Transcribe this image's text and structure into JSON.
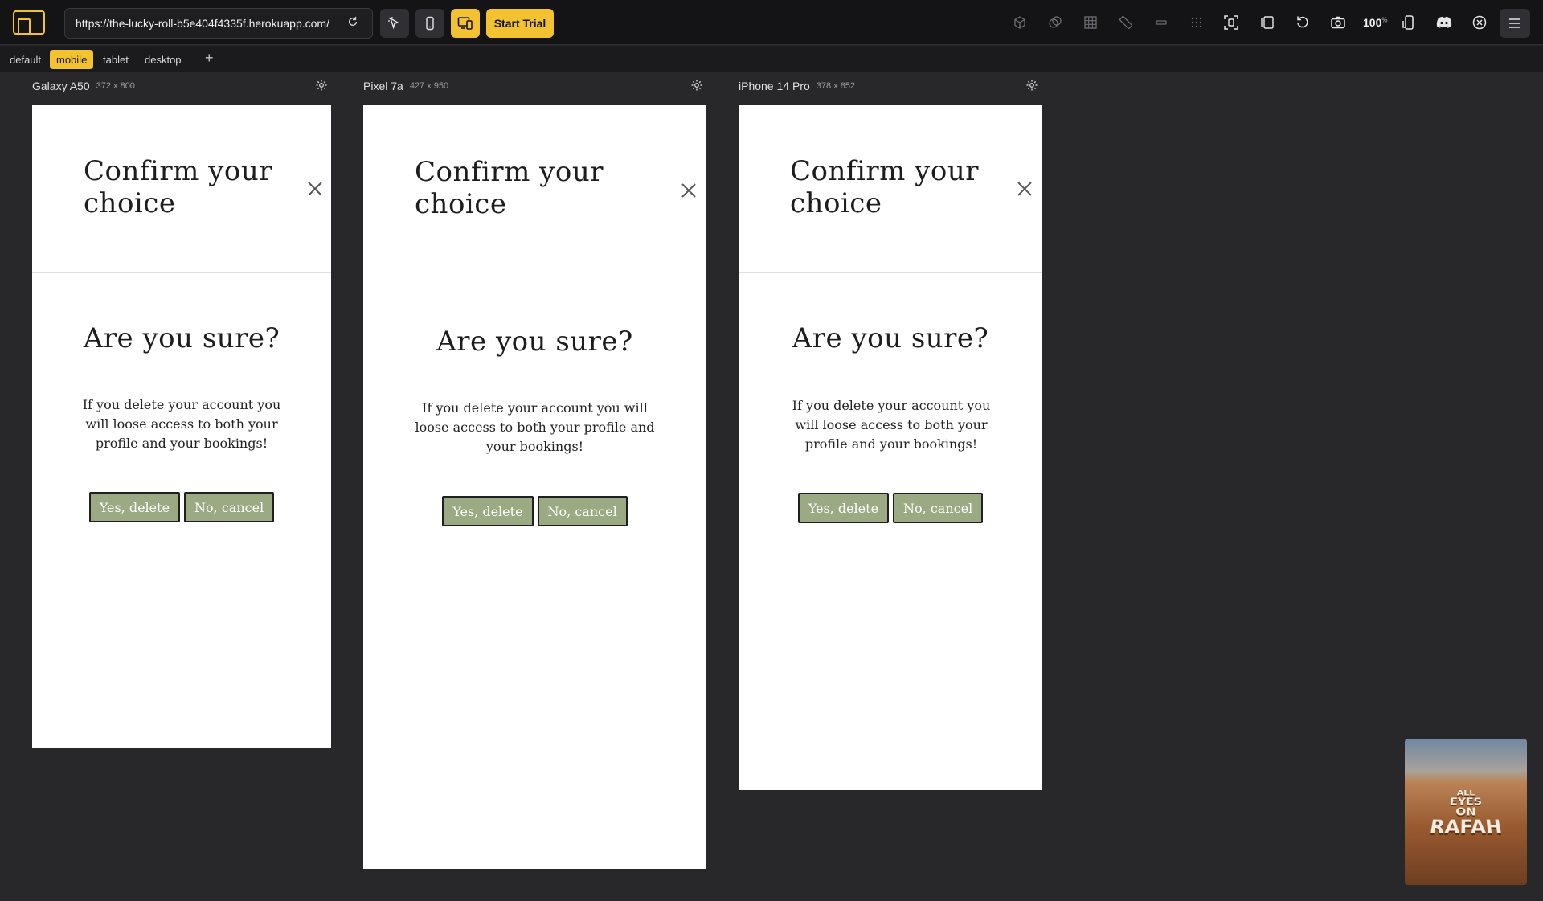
{
  "toolbar": {
    "url": "https://the-lucky-roll-b5e404f4335f.herokuapp.com/",
    "start_trial_label": "Start Trial",
    "zoom_value": "100",
    "zoom_unit": "%",
    "accent_color": "#f2c230"
  },
  "tabs": {
    "items": [
      {
        "label": "default"
      },
      {
        "label": "mobile"
      },
      {
        "label": "tablet"
      },
      {
        "label": "desktop"
      }
    ],
    "active": "mobile",
    "add_label": "+"
  },
  "devices": [
    {
      "name": "Galaxy A50",
      "dimensions": "372 x 800"
    },
    {
      "name": "Pixel 7a",
      "dimensions": "427 x 950"
    },
    {
      "name": "iPhone 14 Pro",
      "dimensions": "378 x 852"
    }
  ],
  "modal": {
    "title": "Confirm your choice",
    "heading": "Are you sure?",
    "message": "If you delete your account you will loose access to both your profile and your bookings!",
    "confirm_label": "Yes, delete",
    "cancel_label": "No, cancel",
    "button_color": "#9aaa82"
  },
  "thumbnail": {
    "lines": [
      "ALL",
      "EYES",
      "ON",
      "RAFAH"
    ]
  }
}
